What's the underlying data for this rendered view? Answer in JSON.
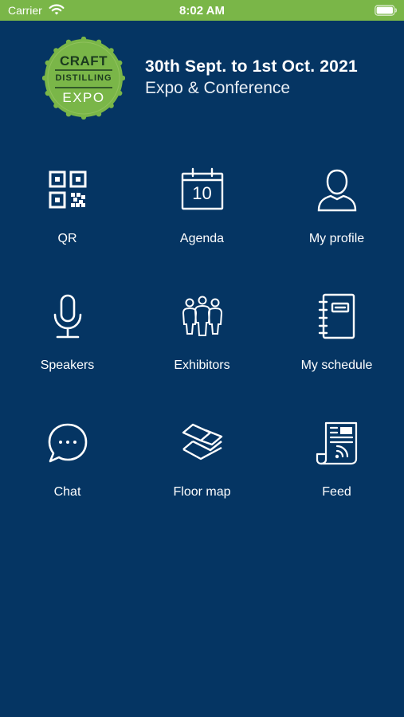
{
  "status_bar": {
    "carrier": "Carrier",
    "time": "8:02 AM",
    "background": "#7ab648",
    "wifi_icon": "wifi-icon",
    "battery_icon": "battery-icon"
  },
  "header": {
    "logo": {
      "line1": "CRAFT",
      "line2": "DISTILLING",
      "line3": "EXPO",
      "color": "#7ab648"
    },
    "dates": "30th Sept. to 1st Oct. 2021",
    "subtitle": "Expo & Conference"
  },
  "theme": {
    "background": "#053563",
    "text": "#ffffff"
  },
  "menu": [
    {
      "label": "QR",
      "icon": "qr-code-icon"
    },
    {
      "label": "Agenda",
      "icon": "calendar-icon",
      "calendar_day": "10"
    },
    {
      "label": "My profile",
      "icon": "user-icon"
    },
    {
      "label": "Speakers",
      "icon": "microphone-icon"
    },
    {
      "label": "Exhibitors",
      "icon": "people-group-icon"
    },
    {
      "label": "My schedule",
      "icon": "notebook-icon"
    },
    {
      "label": "Chat",
      "icon": "chat-bubble-icon"
    },
    {
      "label": "Floor map",
      "icon": "layers-map-icon"
    },
    {
      "label": "Feed",
      "icon": "news-feed-icon"
    }
  ]
}
